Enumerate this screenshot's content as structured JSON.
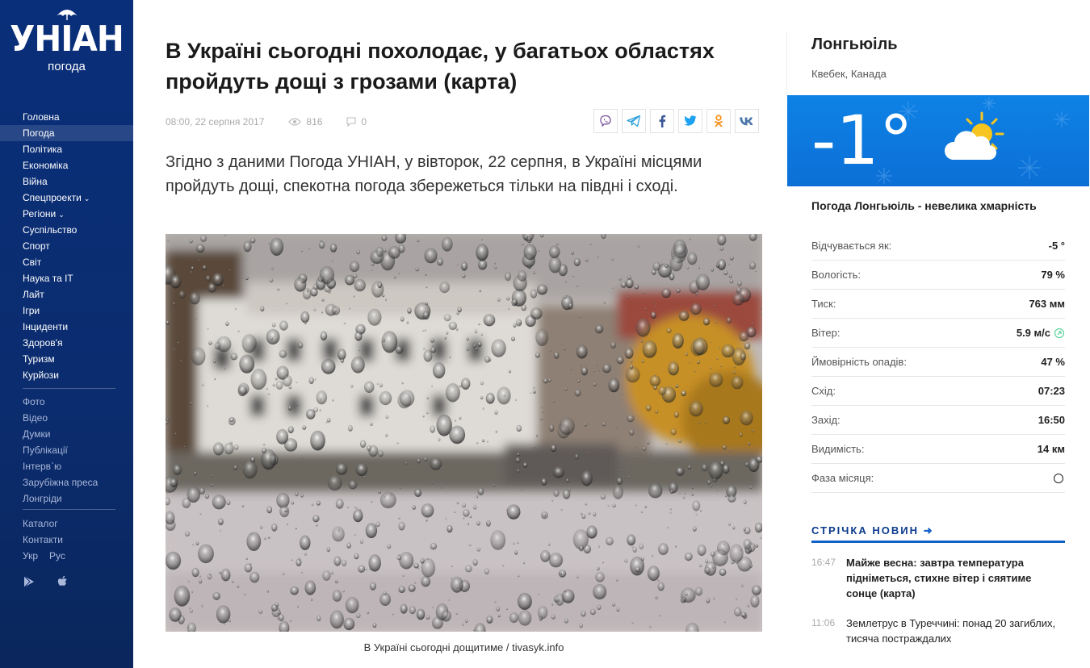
{
  "logo": {
    "text": "УНІАН",
    "sub": "погода"
  },
  "nav": {
    "main": [
      {
        "label": "Головна"
      },
      {
        "label": "Погода",
        "active": true
      },
      {
        "label": "Політика"
      },
      {
        "label": "Економіка"
      },
      {
        "label": "Війна"
      },
      {
        "label": "Спецпроекти",
        "dropdown": true
      },
      {
        "label": "Регіони",
        "dropdown": true
      },
      {
        "label": "Суспільство"
      },
      {
        "label": "Спорт"
      },
      {
        "label": "Світ"
      },
      {
        "label": "Наука та IT"
      },
      {
        "label": "Лайт"
      },
      {
        "label": "Ігри"
      },
      {
        "label": "Інциденти"
      },
      {
        "label": "Здоров'я"
      },
      {
        "label": "Туризм"
      },
      {
        "label": "Курйози"
      }
    ],
    "secondary": [
      "Фото",
      "Відео",
      "Думки",
      "Публікації",
      "Інтерв`ю",
      "Зарубіжна преса",
      "Лонгріди"
    ],
    "tertiary": [
      "Каталог",
      "Контакти"
    ],
    "langs": [
      "Укр",
      "Рус"
    ],
    "apps": [
      "google-play-icon",
      "apple-icon"
    ]
  },
  "article": {
    "title": "В Україні сьогодні похолодає, у багатьох областях пройдуть дощі з грозами (карта)",
    "datetime": "08:00, 22 серпня 2017",
    "views": "816",
    "comments": "0",
    "share": [
      "viber",
      "telegram",
      "facebook",
      "twitter",
      "odnoklassniki",
      "vk"
    ],
    "lead": "Згідно з даними Погода УНІАН, у вівторок, 22 серпня, в Україні місцями пройдуть дощі, спекотна погода збережеться тільки на півдні і сході.",
    "caption": "В Україні сьогодні дощитиме / tivasyk.info"
  },
  "weather": {
    "city": "Лонгьюіль",
    "region": "Квебек, Канада",
    "temp": "-1°",
    "description": "Погода Лонгьюіль - невелика хмарність",
    "icon": "partly-cloudy-icon",
    "params": [
      {
        "label": "Відчувається як:",
        "value": "-5 °"
      },
      {
        "label": "Вологість:",
        "value": "79 %"
      },
      {
        "label": "Тиск:",
        "value": "763 мм"
      },
      {
        "label": "Вітер:",
        "value": "5.9 м/с"
      },
      {
        "label": "Ймовірність опадів:",
        "value": "47 %"
      },
      {
        "label": "Схід:",
        "value": "07:23"
      },
      {
        "label": "Захід:",
        "value": "16:50"
      },
      {
        "label": "Видимість:",
        "value": "14 км"
      },
      {
        "label": "Фаза місяця:",
        "value": ""
      }
    ]
  },
  "feed": {
    "title": "СТРІЧКА НОВИН",
    "items": [
      {
        "time": "16:47",
        "text": "Майже весна: завтра температура підніметься, стихне вітер і сяятиме сонце (карта)",
        "bold": true
      },
      {
        "time": "11:06",
        "text": "Землетрус в Туреччині: понад 20 загиблих, тисяча постраждалих",
        "bold": false
      }
    ]
  },
  "colors": {
    "sidebar": "#0a2f7a",
    "accent": "#1160c9",
    "weather_panel": "#0e82e6"
  }
}
